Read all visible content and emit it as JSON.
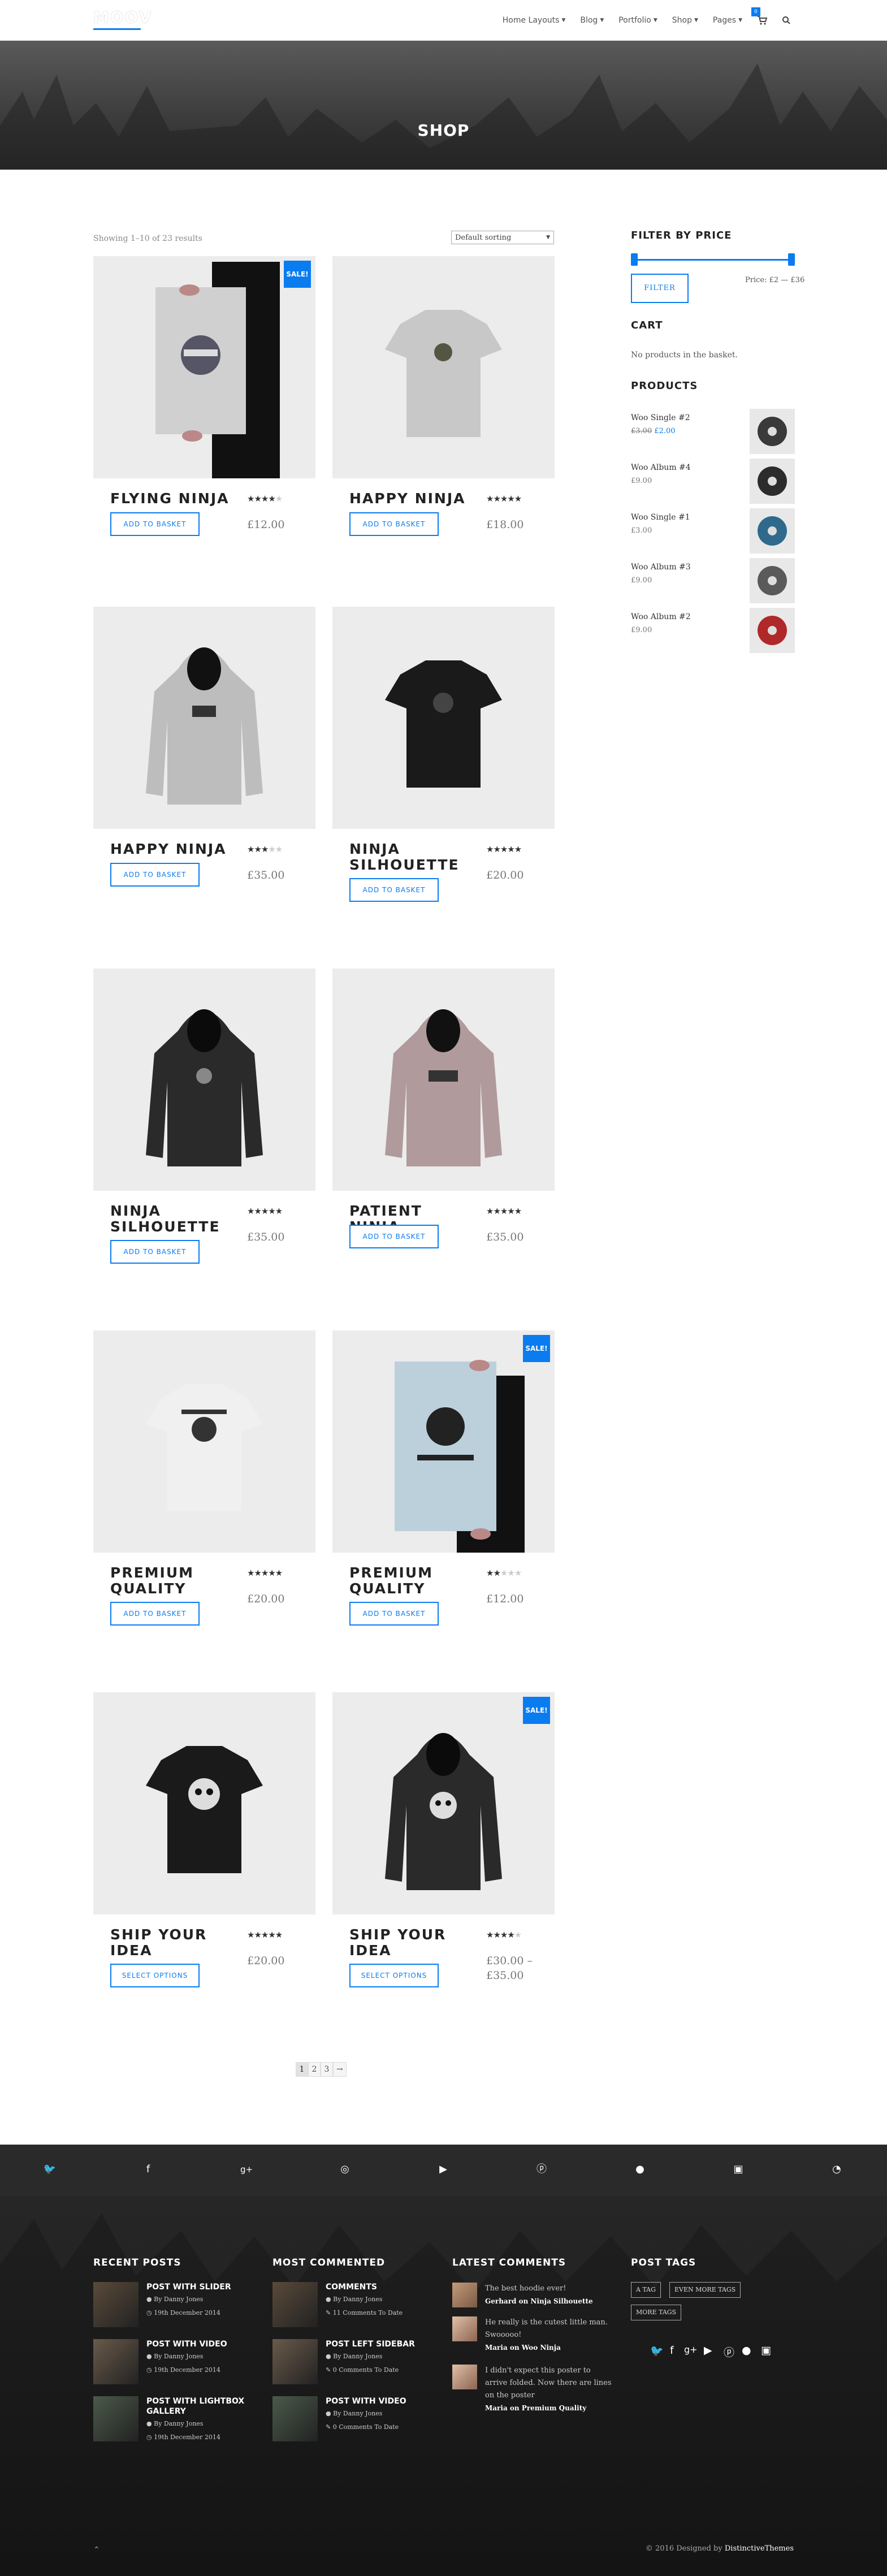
{
  "header": {
    "logo": "MOOV",
    "menu": [
      "Home Layouts",
      "Blog",
      "Portfolio",
      "Shop",
      "Pages"
    ],
    "cart_count": "0"
  },
  "hero": {
    "title": "SHOP"
  },
  "shop": {
    "result_count": "Showing 1–10 of 23 results",
    "sorting": "Default sorting",
    "sale_label": "SALE!",
    "products": [
      {
        "name": "FLYING NINJA",
        "rating": 4,
        "price_old": "",
        "price": "£12.00",
        "button": "ADD TO BASKET",
        "sale": true,
        "image": "poster"
      },
      {
        "name": "HAPPY NINJA",
        "rating": 5,
        "price_old": "",
        "price": "£18.00",
        "button": "ADD TO BASKET",
        "sale": false,
        "image": "tshirt-grey"
      },
      {
        "name": "HAPPY NINJA",
        "rating": 3,
        "price_old": "",
        "price": "£35.00",
        "button": "ADD TO BASKET",
        "sale": false,
        "image": "hoodie-grey"
      },
      {
        "name": "NINJA SILHOUETTE",
        "rating": 5,
        "price_old": "",
        "price": "£20.00",
        "button": "ADD TO BASKET",
        "sale": false,
        "image": "tshirt-black"
      },
      {
        "name": "NINJA SILHOUETTE",
        "rating": 4.5,
        "price_old": "",
        "price": "£35.00",
        "button": "ADD TO BASKET",
        "sale": false,
        "image": "hoodie-black"
      },
      {
        "name": "PATIENT NINJA",
        "rating": 5,
        "price_old": "",
        "price": "£35.00",
        "button": "ADD TO BASKET",
        "sale": false,
        "image": "hoodie-pink"
      },
      {
        "name": "PREMIUM QUALITY",
        "rating": 4.5,
        "price_old": "",
        "price": "£20.00",
        "button": "ADD TO BASKET",
        "sale": false,
        "image": "tshirt-white"
      },
      {
        "name": "PREMIUM QUALITY",
        "rating": 2,
        "price_old": "",
        "price": "£12.00",
        "button": "ADD TO BASKET",
        "sale": true,
        "image": "poster-blue"
      },
      {
        "name": "SHIP YOUR IDEA",
        "rating": 4.5,
        "price_old": "",
        "price": "£20.00",
        "button": "SELECT OPTIONS",
        "sale": false,
        "image": "tshirt-skull"
      },
      {
        "name": "SHIP YOUR IDEA",
        "rating": 4,
        "price_old": "",
        "price": "£30.00 – £35.00",
        "button": "SELECT OPTIONS",
        "sale": true,
        "image": "hoodie-skull"
      }
    ]
  },
  "pagination": [
    "1",
    "2",
    "3",
    "→"
  ],
  "sidebar": {
    "filter_title": "FILTER BY PRICE",
    "filter_button": "FILTER",
    "price_range": "Price: £2 — £36",
    "cart_title": "CART",
    "cart_empty": "No products in the basket.",
    "products_title": "PRODUCTS",
    "products": [
      {
        "name": "Woo Single #2",
        "price_old": "£3.00",
        "price": "£2.00",
        "color": "#3a3a3a"
      },
      {
        "name": "Woo Album #4",
        "price_old": "",
        "price": "£9.00",
        "color": "#2c2c2c"
      },
      {
        "name": "Woo Single #1",
        "price_old": "",
        "price": "£3.00",
        "color": "#2f6a8c"
      },
      {
        "name": "Woo Album #3",
        "price_old": "",
        "price": "£9.00",
        "color": "#5a5a5a"
      },
      {
        "name": "Woo Album #2",
        "price_old": "",
        "price": "£9.00",
        "color": "#b0282a"
      }
    ]
  },
  "footer": {
    "recent_title": "RECENT POSTS",
    "recent": [
      {
        "title": "POST WITH SLIDER",
        "author": "By Danny Jones",
        "date": "19th December 2014"
      },
      {
        "title": "POST WITH VIDEO",
        "author": "By Danny Jones",
        "date": "19th December 2014"
      },
      {
        "title": "POST WITH LIGHTBOX GALLERY",
        "author": "By Danny Jones",
        "date": "19th December 2014"
      }
    ],
    "commented_title": "MOST COMMENTED",
    "commented": [
      {
        "title": "COMMENTS",
        "author": "By Danny Jones",
        "count": "11 Comments To Date"
      },
      {
        "title": "POST LEFT SIDEBAR",
        "author": "By Danny Jones",
        "count": "0 Comments To Date"
      },
      {
        "title": "POST WITH VIDEO",
        "author": "By Danny Jones",
        "count": "0 Comments To Date"
      }
    ],
    "comments_title": "LATEST COMMENTS",
    "comments": [
      {
        "text": "The best hoodie ever!",
        "by": "Gerhard on Ninja Silhouette"
      },
      {
        "text": "He really is the cutest little man. Swooooo!",
        "by": "Maria on Woo Ninja"
      },
      {
        "text": "I didn't expect this poster to arrive folded. Now there are lines on the poster",
        "by": "Maria on Premium Quality"
      }
    ],
    "tags_title": "POST TAGS",
    "tags": [
      "A TAG",
      "EVEN MORE TAGS",
      "MORE TAGS"
    ],
    "copyright": "© 2016 Designed by",
    "copyright_brand": "DistinctiveThemes"
  },
  "colors": {
    "accent": "#0a7cf0",
    "footer_bg": "#1b1b1b"
  }
}
